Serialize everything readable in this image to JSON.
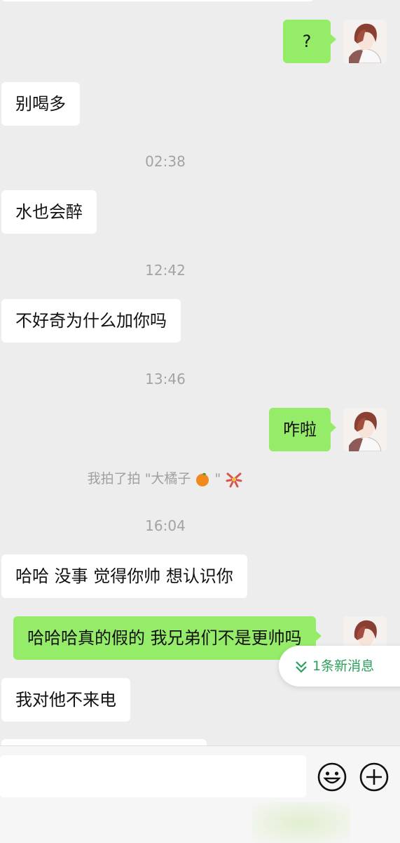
{
  "messages": {
    "m1": "?",
    "m2": "别喝多",
    "t1": "02:38",
    "m3": "水也会醉",
    "t2": "12:42",
    "m4": "不好奇为什么加你吗",
    "t3": "13:46",
    "m5": "咋啦",
    "pat_text": "我拍了拍 \"大橘子",
    "pat_quote": "\"",
    "t4": "16:04",
    "m6": "哈哈 没事 觉得你帅 想认识你",
    "m7": "哈哈哈真的假的 我兄弟们不是更帅吗",
    "m8": "我对他不来电"
  },
  "new_message_tip": "1条新消息",
  "icons": {
    "avatar": "anime-boy-avatar",
    "emoji": "smiley-face-icon",
    "plus": "plus-circle-icon",
    "chevrons": "double-chevron-down-icon"
  },
  "colors": {
    "background": "#ededed",
    "sent_bubble": "#95ec69",
    "received_bubble": "#ffffff",
    "accent_green": "#2aa05a"
  }
}
